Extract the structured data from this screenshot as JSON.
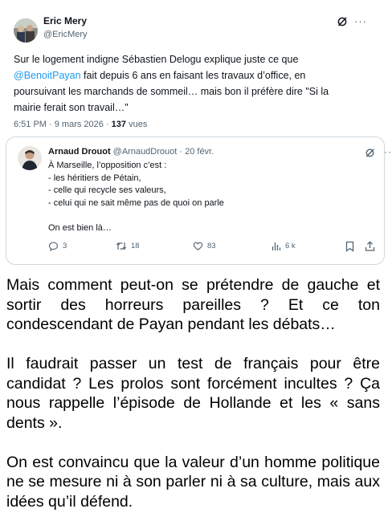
{
  "tweet": {
    "author_name": "Eric Mery",
    "author_handle": "@EricMery",
    "text_before": "Sur le logement indigne Sébastien Delogu explique juste ce que ",
    "mention": "@BenoitPayan",
    "text_after": " fait depuis 6 ans en faisant les travaux d’office, en poursuivant les marchands de sommeil… mais bon il préfère dire \"Si la mairie ferait son travail…\"",
    "timestamp": "6:51 PM · 9 mars 2026 · ",
    "views_count": "137",
    "views_label": " vues",
    "icons": [
      "avatar",
      "grok-icon",
      "more-icon"
    ]
  },
  "quote": {
    "author_name": "Arnaud Drouot",
    "handle_date": " @ArnaudDrouot · 20 févr.",
    "text": "À Marseille, l’opposition c’est :\n- les héritiers de Pétain,\n- celle qui recycle ses valeurs,\n- celui qui ne sait même pas de quoi on parle\n\nOn est bien là…",
    "actions": {
      "replies": "3",
      "reposts": "18",
      "likes": "83",
      "views": "6 k"
    },
    "icons": [
      "reply-icon",
      "repost-icon",
      "like-icon",
      "views-icon",
      "bookmark-icon",
      "share-icon"
    ]
  },
  "article": {
    "paragraphs": [
      "Mais comment peut-on se prétendre de gauche et sortir des horreurs pareilles ? Et ce ton condescendant de Payan pendant les débats…",
      "Il faudrait passer un test de français pour être candidat ? Les prolos sont forcément incultes ? Ça nous rappelle l’épisode de Hollande et les « sans dents ».",
      "On est convaincu que la valeur d’un homme politique ne se mesure ni à son parler ni à sa culture, mais aux idées qu’il défend."
    ]
  },
  "colors": {
    "text": "#0f1419",
    "secondary": "#536471",
    "link": "#1d9bf0",
    "border": "#cfd9de"
  }
}
